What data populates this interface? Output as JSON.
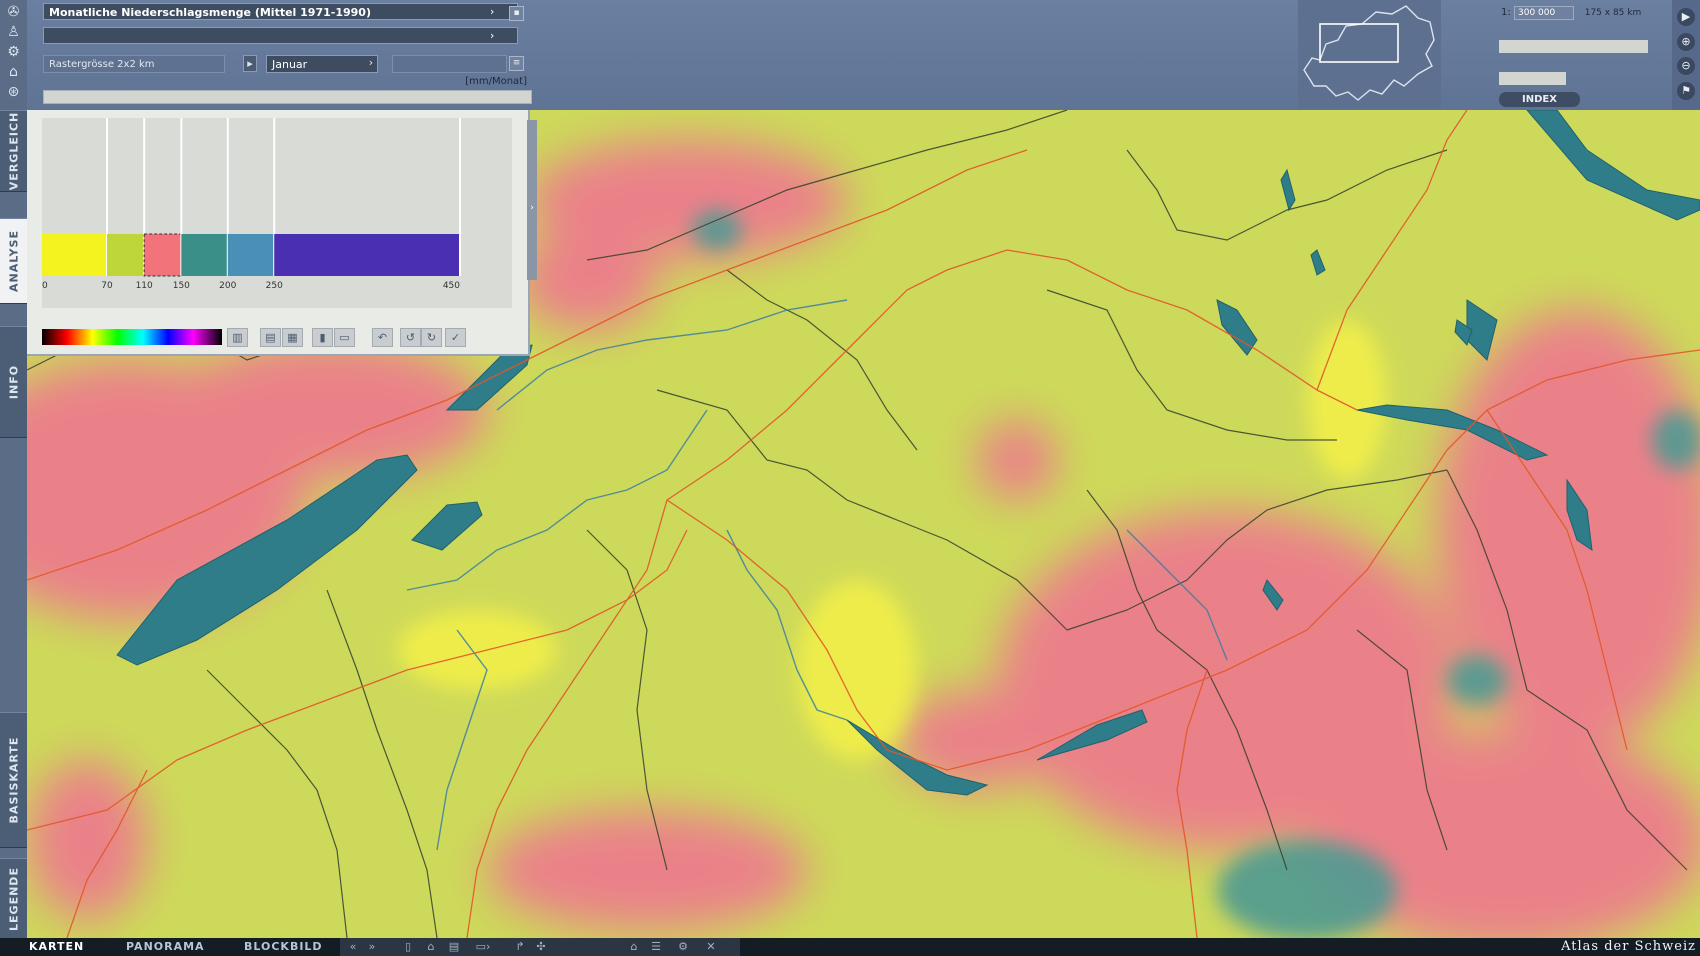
{
  "app_brand": "Atlas der Schweiz",
  "header": {
    "map_title": "Monatliche Niederschlagsmenge (Mittel 1971-1990)",
    "secondary_title": "",
    "resolution": "Rastergrösse 2x2 km",
    "month": "Januar",
    "unit": "[mm/Monat]"
  },
  "scale": {
    "prefix": "1:",
    "value": "300 000",
    "extent": "175 x 85 km",
    "index_label": "INDEX"
  },
  "left_tabs": [
    "VERGLEICH",
    "ANALYSE",
    "INFO",
    "BASISKARTE",
    "LEGENDE"
  ],
  "active_left_tab": "ANALYSE",
  "bottom_tabs": [
    "KARTEN",
    "PANORAMA",
    "BLOCKBILD"
  ],
  "active_bottom_tab": "KARTEN",
  "legend": {
    "classes": [
      {
        "from": 0,
        "to": 70,
        "color": "#f4f21f"
      },
      {
        "from": 70,
        "to": 110,
        "color": "#bfd63a"
      },
      {
        "from": 110,
        "to": 150,
        "color": "#f2737a"
      },
      {
        "from": 150,
        "to": 200,
        "color": "#3a8f88"
      },
      {
        "from": 200,
        "to": 250,
        "color": "#4a8fb5"
      },
      {
        "from": 250,
        "to": 450,
        "color": "#4b2fb2"
      }
    ],
    "tick_labels": [
      "0",
      "70",
      "110",
      "150",
      "200",
      "250",
      "450"
    ],
    "max": 450
  },
  "icons": {
    "left_tools": [
      "compass-icon",
      "landmark-icon",
      "gear-icon",
      "building-icon",
      "tags-icon"
    ],
    "right_tools": [
      "play-icon",
      "zoom-in-icon",
      "zoom-out-icon",
      "flag-icon"
    ],
    "bottom_tools": [
      "back-icon",
      "forward-icon",
      "page-icon",
      "lock-icon",
      "print-icon",
      "export-icon",
      "cursor-icon",
      "rotate-icon",
      "home-icon",
      "list-icon",
      "settings-icon",
      "close-icon"
    ]
  }
}
